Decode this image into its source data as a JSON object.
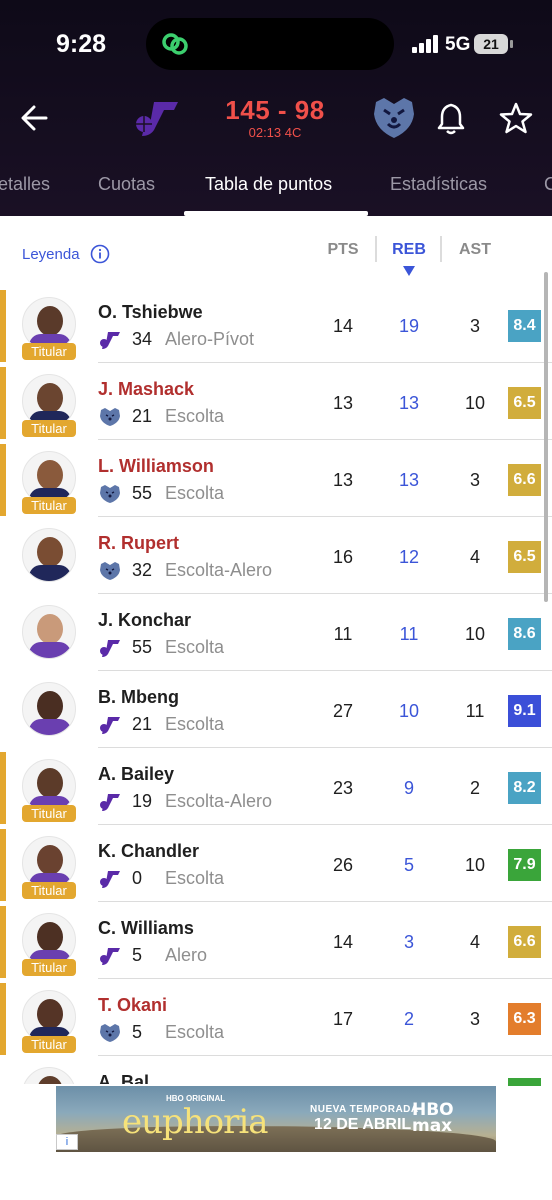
{
  "status_bar": {
    "time": "9:28",
    "network": "5G",
    "battery": "21"
  },
  "game": {
    "score": "145 - 98",
    "clock": "02:13 4C"
  },
  "tabs": [
    {
      "label": "etalles"
    },
    {
      "label": "Cuotas"
    },
    {
      "label": "Tabla de puntos"
    },
    {
      "label": "Estadísticas"
    },
    {
      "label": "C"
    }
  ],
  "table": {
    "legend_label": "Leyenda",
    "columns": {
      "pts": "PTS",
      "reb": "REB",
      "ast": "AST"
    },
    "starter_label": "Titular",
    "rows": [
      {
        "name": "O. Tshiebwe",
        "team": "jazz",
        "number": "34",
        "position": "Alero-Pívot",
        "pts": "14",
        "reb": "19",
        "ast": "3",
        "rating": "8.4",
        "rating_color": "#4aa3c4",
        "starter": true
      },
      {
        "name": "J. Mashack",
        "team": "grizzlies",
        "number": "21",
        "position": "Escolta",
        "pts": "13",
        "reb": "13",
        "ast": "10",
        "rating": "6.5",
        "rating_color": "#d1ad3c",
        "starter": true
      },
      {
        "name": "L. Williamson",
        "team": "grizzlies",
        "number": "55",
        "position": "Escolta",
        "pts": "13",
        "reb": "13",
        "ast": "3",
        "rating": "6.6",
        "rating_color": "#d1ad3c",
        "starter": true
      },
      {
        "name": "R. Rupert",
        "team": "grizzlies",
        "number": "32",
        "position": "Escolta-Alero",
        "pts": "16",
        "reb": "12",
        "ast": "4",
        "rating": "6.5",
        "rating_color": "#d1ad3c",
        "starter": false
      },
      {
        "name": "J. Konchar",
        "team": "jazz",
        "number": "55",
        "position": "Escolta",
        "pts": "11",
        "reb": "11",
        "ast": "10",
        "rating": "8.6",
        "rating_color": "#4aa3c4",
        "starter": false
      },
      {
        "name": "B. Mbeng",
        "team": "jazz",
        "number": "21",
        "position": "Escolta",
        "pts": "27",
        "reb": "10",
        "ast": "11",
        "rating": "9.1",
        "rating_color": "#3b4fd8",
        "starter": false
      },
      {
        "name": "A. Bailey",
        "team": "jazz",
        "number": "19",
        "position": "Escolta-Alero",
        "pts": "23",
        "reb": "9",
        "ast": "2",
        "rating": "8.2",
        "rating_color": "#4aa3c4",
        "starter": true
      },
      {
        "name": "K. Chandler",
        "team": "jazz",
        "number": "0",
        "position": "Escolta",
        "pts": "26",
        "reb": "5",
        "ast": "10",
        "rating": "7.9",
        "rating_color": "#3aa53a",
        "starter": true
      },
      {
        "name": "C. Williams",
        "team": "jazz",
        "number": "5",
        "position": "Alero",
        "pts": "14",
        "reb": "3",
        "ast": "4",
        "rating": "6.6",
        "rating_color": "#d1ad3c",
        "starter": true
      },
      {
        "name": "T. Okani",
        "team": "grizzlies",
        "number": "5",
        "position": "Escolta",
        "pts": "17",
        "reb": "2",
        "ast": "3",
        "rating": "6.3",
        "rating_color": "#e37d2c",
        "starter": true
      },
      {
        "name": "A. Bal",
        "team": "jazz",
        "number": "",
        "position": "",
        "pts": "",
        "reb": "",
        "ast": "",
        "rating": "",
        "rating_color": "#3aa53a",
        "starter": false
      }
    ]
  },
  "ad": {
    "small": "HBO ORIGINAL",
    "title": "euphoria",
    "line1": "NUEVA TEMPORADA",
    "line2": "12 DE ABRIL",
    "logo": "HBO max",
    "info": "i"
  },
  "colors": {
    "away_name": "#b12f2e",
    "accent": "#3b55d8",
    "starter": "#e3a72f",
    "score": "#f0504a"
  }
}
